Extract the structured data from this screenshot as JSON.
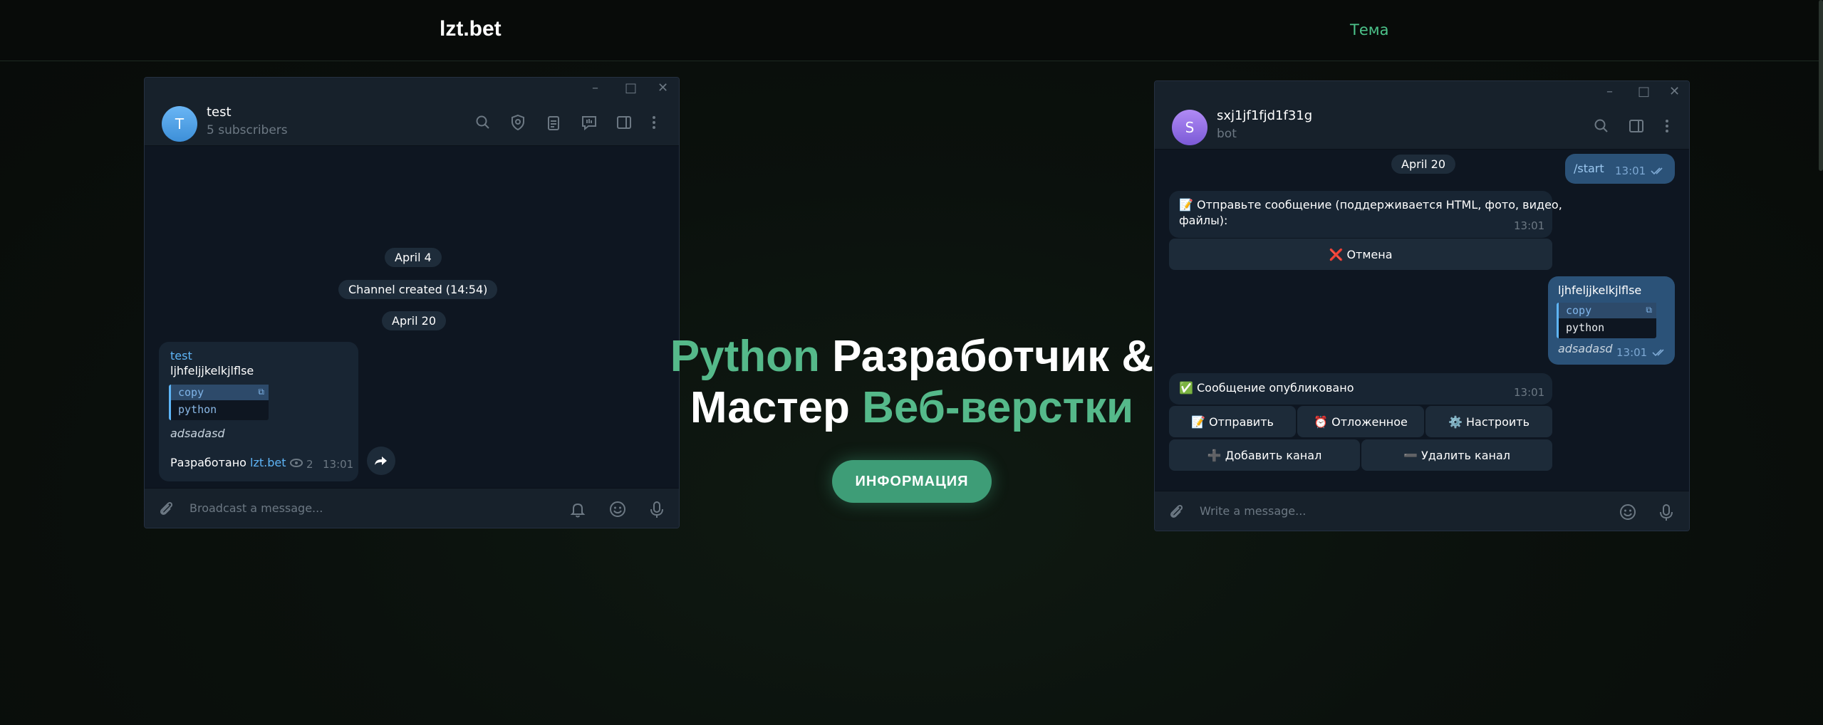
{
  "site": {
    "logo": "lzt.bet",
    "nav_theme": "Тема"
  },
  "hero": {
    "line1_green": "Python",
    "line1_white": " Разработчик &",
    "line2_white": "Мастер ",
    "line2_green": "Веб-верстки",
    "info_button": "ИНФОРМАЦИЯ"
  },
  "left_window": {
    "title": "test",
    "subtitle": "5 subscribers",
    "avatar_letter": "T",
    "date1": "April 4",
    "service": "Channel created (14:54)",
    "date2": "April 20",
    "post": {
      "sender": "test",
      "text": "ljhfeljjkelkjlflse",
      "code_lang": "copy",
      "code_text": "python",
      "italic": "adsadasd",
      "footer_prefix": "Разработано ",
      "footer_link": "lzt.bet",
      "views": "2",
      "time": "13:01"
    },
    "composer_placeholder": "Broadcast a message..."
  },
  "right_window": {
    "title": "sxj1jf1fjd1f31g",
    "subtitle": "bot",
    "avatar_letter": "S",
    "date": "April 20",
    "msg_start": {
      "text": "/start",
      "time": "13:01"
    },
    "msg_prompt": {
      "text": "📝 Отправьте сообщение (поддерживается HTML, фото, видео, файлы):",
      "line1": "📝 Отправьте сообщение (поддерживается HTML, фото, видео,",
      "line2": "файлы):",
      "time": "13:01"
    },
    "btn_cancel": "❌ Отмена",
    "msg_echo": {
      "text": "ljhfeljjkelkjlflse",
      "code_lang": "copy",
      "code_text": "python",
      "italic": "adsadasd",
      "time": "13:01"
    },
    "msg_published": {
      "text": "✅ Сообщение опубликовано",
      "time": "13:01"
    },
    "buttons": {
      "send": "📝 Отправить",
      "delayed": "⏰ Отложенное",
      "settings": "⚙️ Настроить",
      "add_channel": "➕ Добавить канал",
      "remove_channel": "➖ Удалить канал"
    },
    "composer_placeholder": "Write a message..."
  },
  "colors": {
    "accent_green": "#55b98a",
    "tg_bg": "#0e1621",
    "tg_header": "#17212b",
    "tg_out": "#2b5278",
    "tg_in": "#182533",
    "tg_link": "#5eb5f7"
  },
  "icons": [
    "search-icon",
    "shield-icon",
    "clipboard-icon",
    "stats-icon",
    "sidebar-icon",
    "more-icon",
    "attach-icon",
    "bell-icon",
    "emoji-icon",
    "mic-icon",
    "eye-icon",
    "forward-icon",
    "check-double-icon"
  ]
}
